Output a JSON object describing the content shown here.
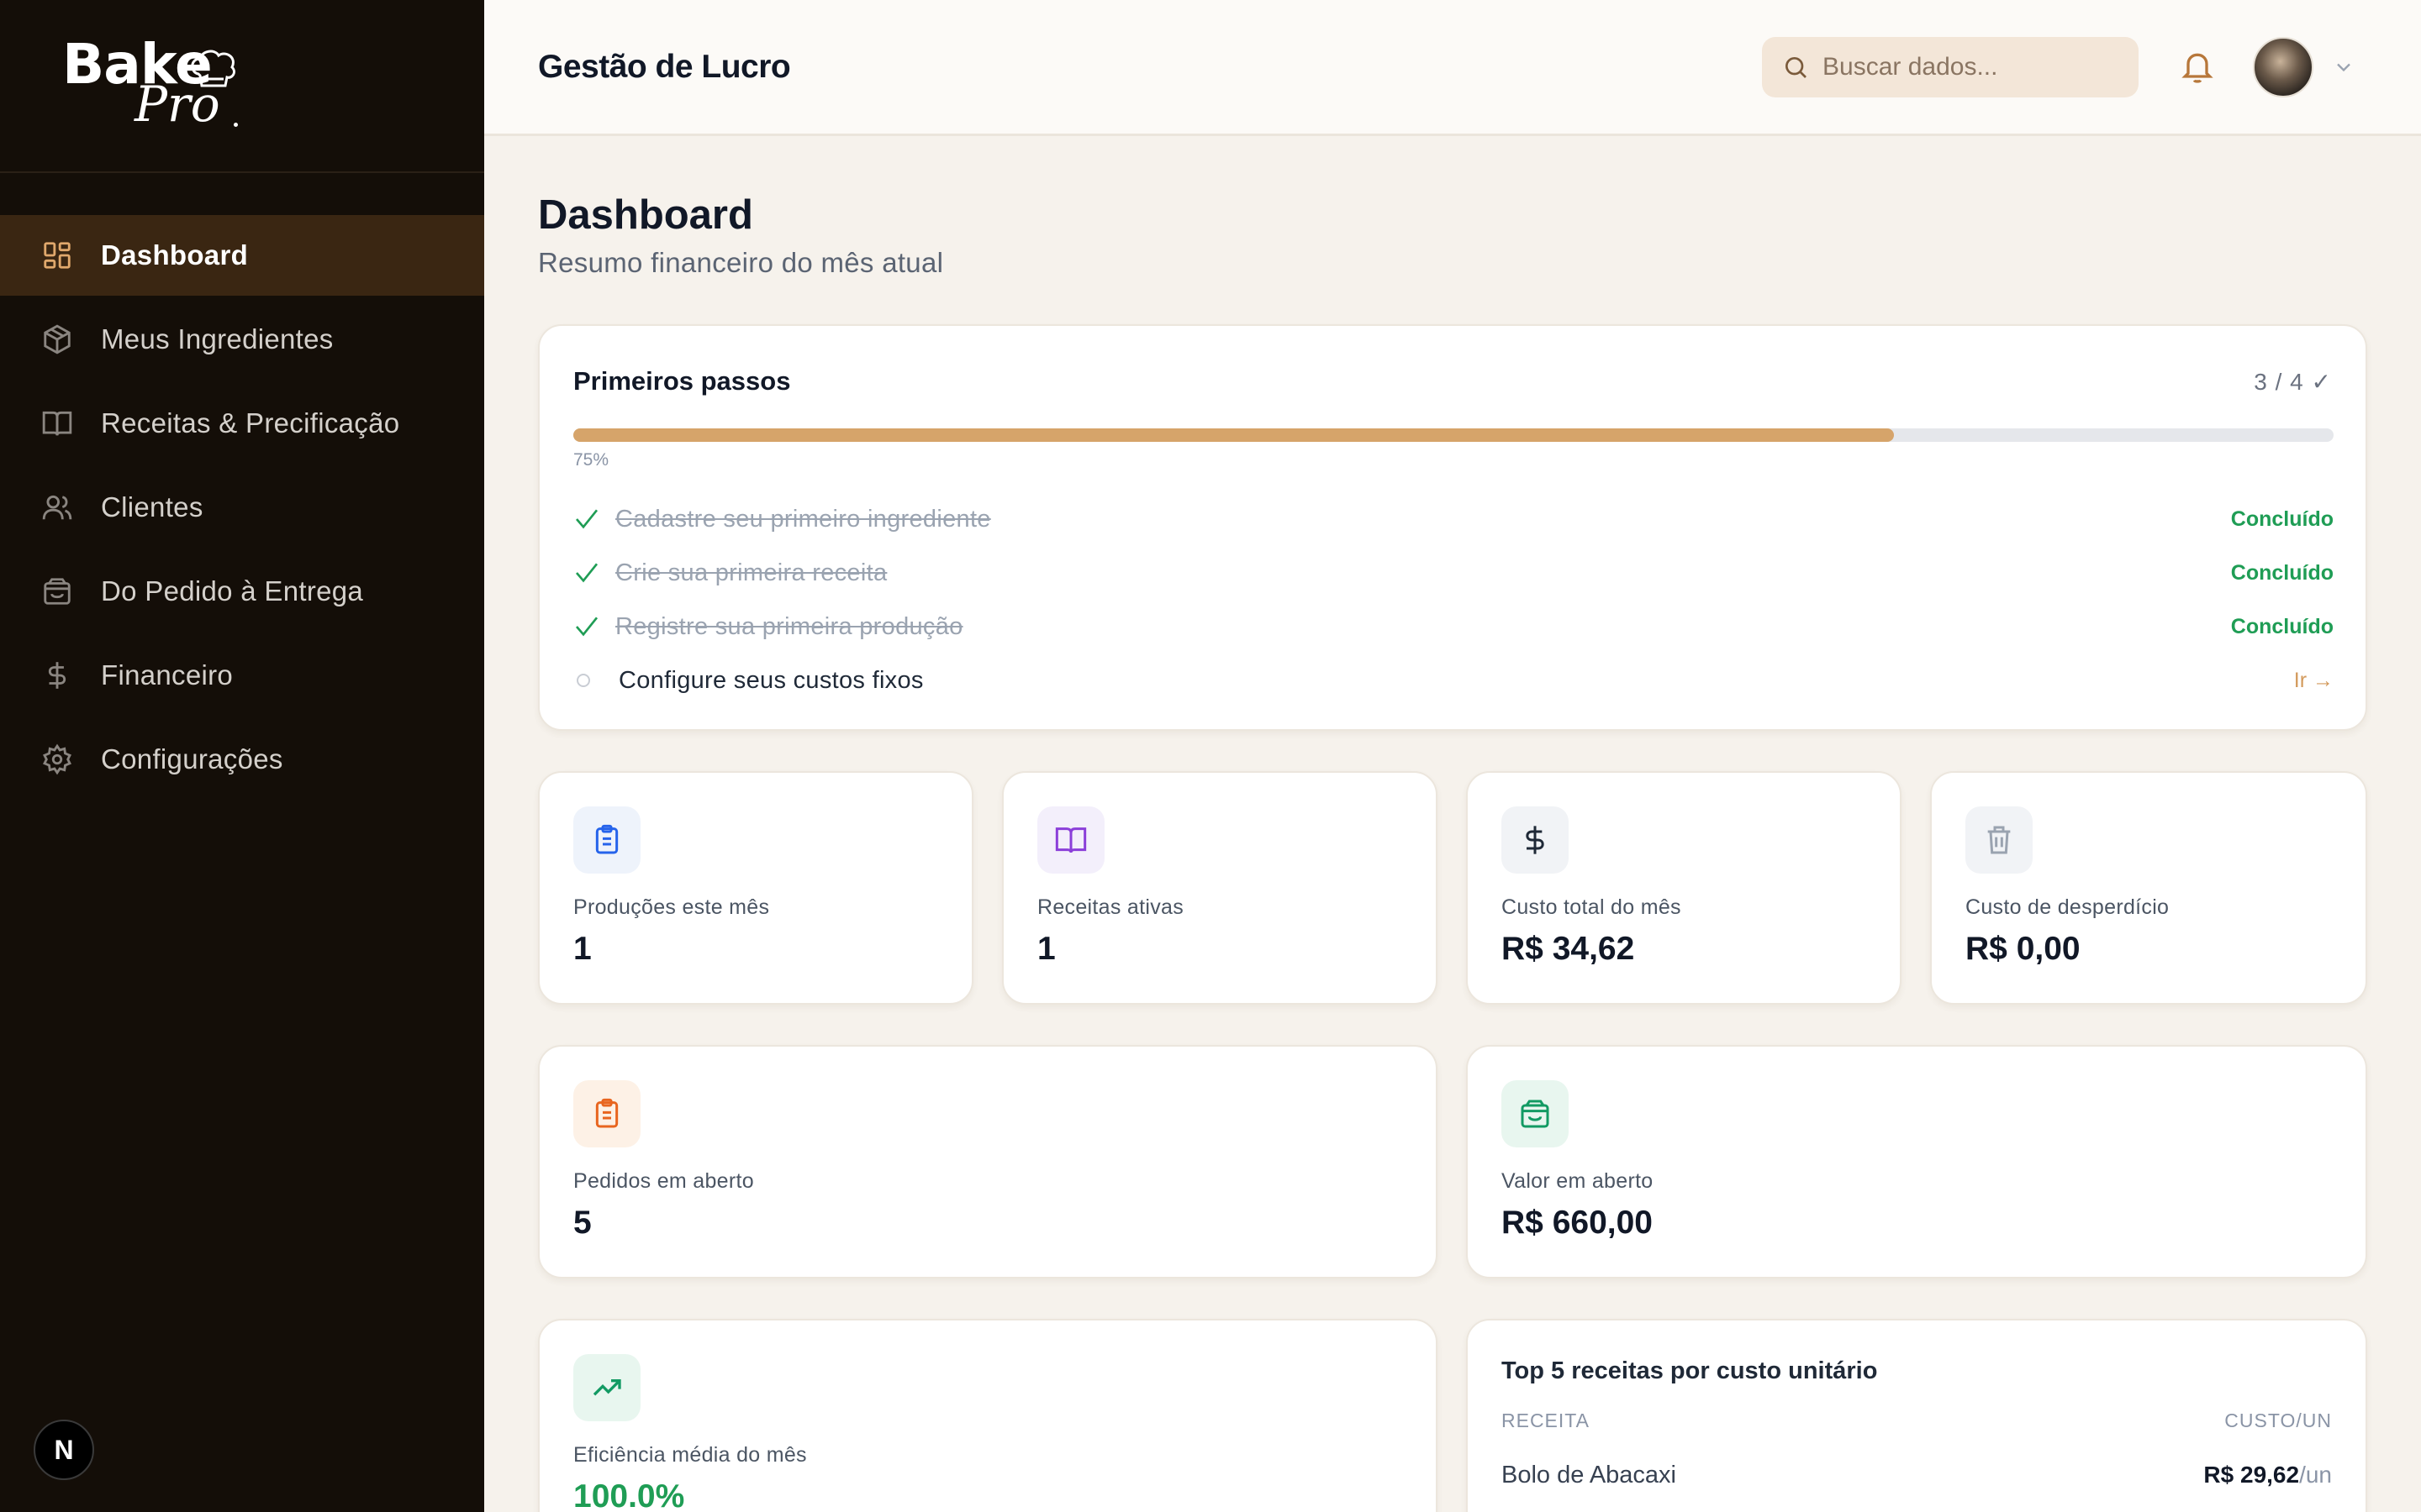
{
  "brand": {
    "name_main": "Bake",
    "name_sub": "Pro"
  },
  "sidebar": {
    "items": [
      {
        "label": "Dashboard",
        "icon": "dashboard-icon",
        "active": true
      },
      {
        "label": "Meus Ingredientes",
        "icon": "box-icon"
      },
      {
        "label": "Receitas & Precificação",
        "icon": "book-icon"
      },
      {
        "label": "Clientes",
        "icon": "users-icon"
      },
      {
        "label": "Do Pedido à Entrega",
        "icon": "bag-icon"
      },
      {
        "label": "Financeiro",
        "icon": "dollar-icon"
      },
      {
        "label": "Configurações",
        "icon": "gear-icon"
      }
    ],
    "badge": "N"
  },
  "header": {
    "title": "Gestão de Lucro",
    "search_placeholder": "Buscar dados..."
  },
  "page": {
    "title": "Dashboard",
    "subtitle": "Resumo financeiro do mês atual"
  },
  "onboarding": {
    "title": "Primeiros passos",
    "count": "3 / 4 ✓",
    "progress_label": "75%",
    "progress_fraction": 0.75,
    "steps": [
      {
        "label": "Cadastre seu primeiro ingrediente",
        "status": "Concluído",
        "done": true
      },
      {
        "label": "Crie sua primeira receita",
        "status": "Concluído",
        "done": true
      },
      {
        "label": "Registre sua primeira produção",
        "status": "Concluído",
        "done": true
      },
      {
        "label": "Configure seus custos fixos",
        "status": "Ir →",
        "done": false
      }
    ]
  },
  "stats": {
    "producoes": {
      "title": "Produções este mês",
      "value": "1"
    },
    "receitas": {
      "title": "Receitas ativas",
      "value": "1"
    },
    "custo_total": {
      "title": "Custo total do mês",
      "value": "R$ 34,62"
    },
    "desperdicio": {
      "title": "Custo de desperdício",
      "value": "R$ 0,00"
    },
    "pedidos_abertos": {
      "title": "Pedidos em aberto",
      "value": "5"
    },
    "valor_aberto": {
      "title": "Valor em aberto",
      "value": "R$ 660,00"
    },
    "eficiencia": {
      "title": "Eficiência média do mês",
      "value": "100.0%"
    }
  },
  "top5": {
    "title": "Top 5 receitas por custo unitário",
    "col_recipe": "RECEITA",
    "col_cost": "CUSTO/UN",
    "rows": [
      {
        "name": "Bolo de Abacaxi",
        "value": "R$ 29,62",
        "unit": "/un"
      }
    ]
  },
  "colors": {
    "sidebar_bg": "#140e08",
    "active_item_bg": "#3a2612",
    "accent": "#d6a46a",
    "success": "#1f9d55"
  }
}
